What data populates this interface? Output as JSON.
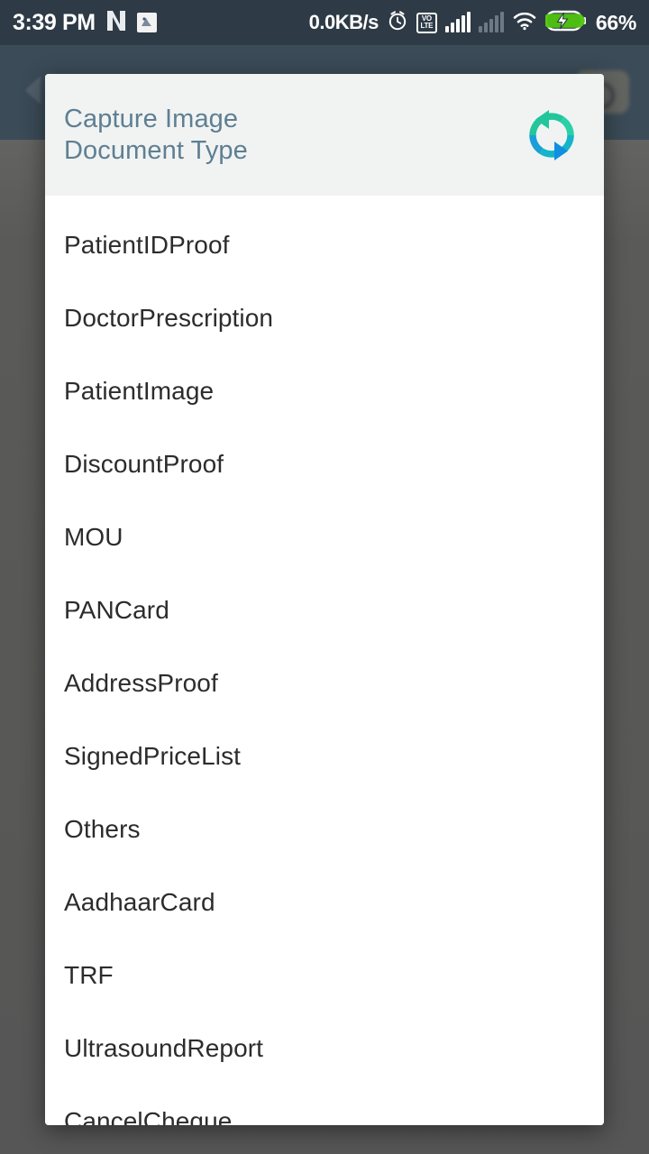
{
  "status_bar": {
    "time": "3:39 PM",
    "network_speed": "0.0KB/s",
    "battery_percent": "66%",
    "icons": [
      "netflix-n-icon",
      "app-notification-icon",
      "alarm-clock-icon",
      "volte-icon",
      "signal-bars-sim1-icon",
      "signal-bars-sim2-icon",
      "wifi-icon",
      "battery-charging-icon"
    ],
    "volte_top": "VO",
    "volte_bottom": "LTE"
  },
  "background_app": {
    "back_button_label": "",
    "camera_button_label": ""
  },
  "dialog": {
    "title_line1": "Capture Image",
    "title_line2": "Document Type",
    "sync_icon": "sync-refresh-icon",
    "items": [
      {
        "label": "PatientIDProof"
      },
      {
        "label": "DoctorPrescription"
      },
      {
        "label": "PatientImage"
      },
      {
        "label": "DiscountProof"
      },
      {
        "label": "MOU"
      },
      {
        "label": "PANCard"
      },
      {
        "label": "AddressProof"
      },
      {
        "label": "SignedPriceList"
      },
      {
        "label": "Others"
      },
      {
        "label": "AadhaarCard"
      },
      {
        "label": "TRF"
      },
      {
        "label": "UltrasoundReport"
      },
      {
        "label": "CancelCheque"
      }
    ]
  },
  "colors": {
    "status_bar_bg": "#2e3a46",
    "app_bar_bg": "#3b4b57",
    "scrim": "#5a5a58",
    "dialog_bg": "#ffffff",
    "dialog_header_bg": "#f1f3f2",
    "title_text": "#5e7f93",
    "item_text": "#2c2c2c",
    "sync_green": "#23c69b",
    "sync_blue": "#118fe0"
  }
}
